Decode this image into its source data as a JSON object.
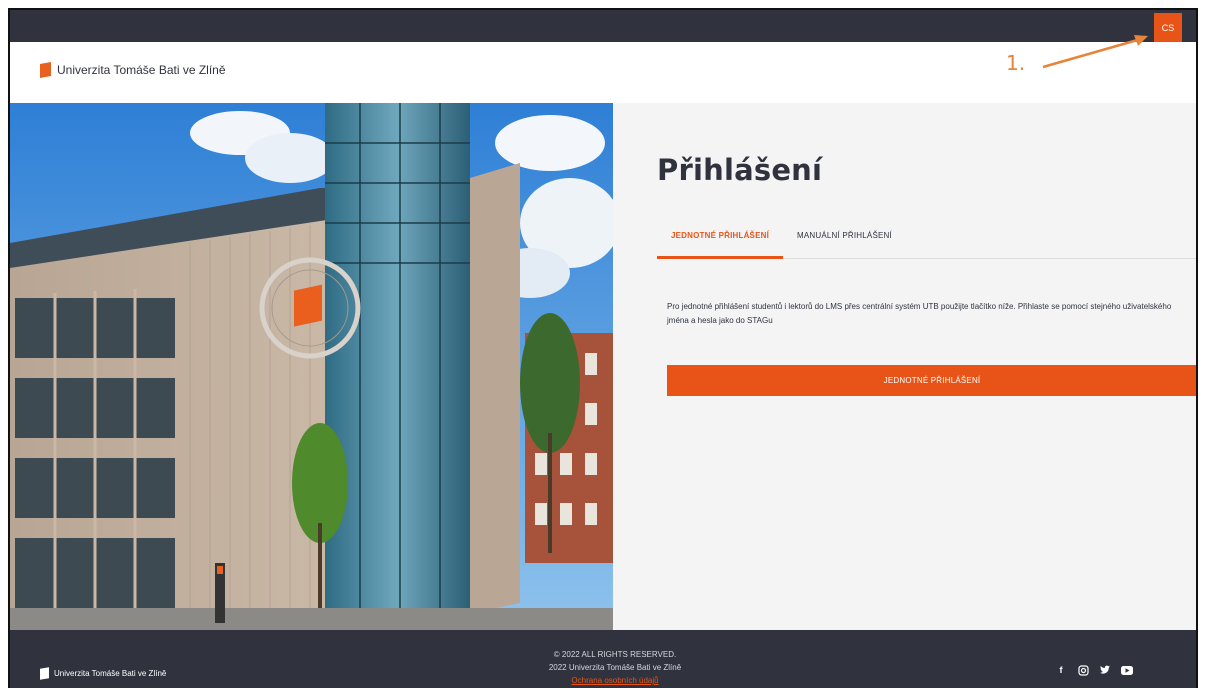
{
  "topbar": {
    "language_label": "CS"
  },
  "annotation": {
    "label": "1."
  },
  "header": {
    "logo_text": "Univerzita Tomáše Bati ve Zlíně"
  },
  "login": {
    "title": "Přihlášení",
    "tabs": [
      {
        "label": "JEDNOTNÉ PŘIHLÁŠENÍ",
        "active": true
      },
      {
        "label": "MANUÁLNÍ PŘIHLÁŠENÍ",
        "active": false
      }
    ],
    "description": "Pro jednotné přihlášení studentů i lektorů do LMS přes centrální systém UTB použijte tlačítko níže. Přihlaste se pomocí stejného uživatelského jména a hesla jako do STAGu",
    "sso_button_label": "JEDNOTNÉ PŘIHLÁŠENÍ"
  },
  "footer": {
    "logo_text": "Univerzita Tomáše Bati ve Zlíně",
    "copyright": "© 2022 ALL RIGHTS RESERVED.",
    "org_line": "2022 Univerzita Tomáše Bati ve Zlíně",
    "privacy_link": "Ochrana osobních údajů",
    "social_icons": [
      "facebook-icon",
      "instagram-icon",
      "twitter-icon",
      "youtube-icon"
    ]
  },
  "colors": {
    "accent": "#e85418",
    "dark": "#30333e",
    "panel": "#f4f4f5"
  }
}
